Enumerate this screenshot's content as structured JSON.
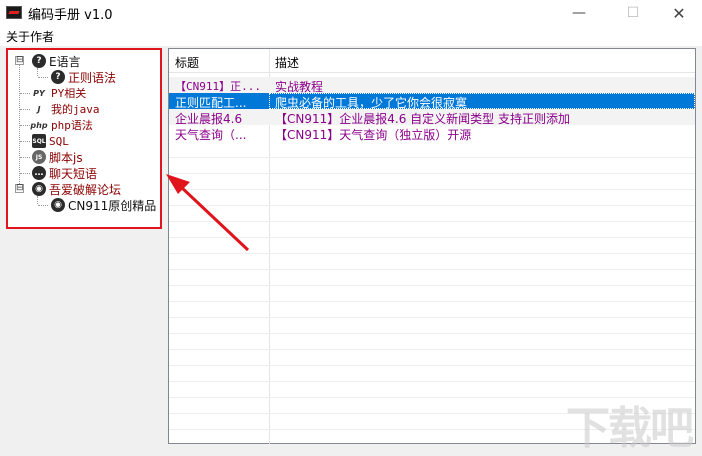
{
  "window": {
    "title": "编码手册 v1.0",
    "minimize": "—",
    "maximize": "☐",
    "close": "✕"
  },
  "menu": {
    "about": "关于作者"
  },
  "tree": {
    "items": [
      {
        "label": "E语言",
        "icon": "question-icon",
        "expander": "⊟"
      },
      {
        "label": "正则语法",
        "icon": "question-icon"
      },
      {
        "label": "PY相关",
        "icon": "py-icon"
      },
      {
        "label": "我的java",
        "icon": "java-icon"
      },
      {
        "label": "php语法",
        "icon": "php-icon"
      },
      {
        "label": "SQL",
        "icon": "sql-icon"
      },
      {
        "label": "脚本js",
        "icon": "js-icon"
      },
      {
        "label": "聊天短语",
        "icon": "chat-icon"
      },
      {
        "label": "吾爱破解论坛",
        "icon": "forum-icon",
        "expander": "⊟"
      },
      {
        "label": "CN911原创精品",
        "icon": "forum-icon"
      }
    ],
    "icon_glyphs": {
      "question": "?",
      "py": "PY",
      "java": "J",
      "php": "php",
      "sql": "SQL",
      "js": "JS",
      "chat": "…",
      "forum": "◉"
    }
  },
  "list": {
    "columns": [
      "标题",
      "描述"
    ],
    "rows": [
      {
        "title": "【CN911】正...",
        "desc": "实战教程"
      },
      {
        "title": "正则匹配工...",
        "desc": "爬虫必备的工具，少了它你会很寂寞"
      },
      {
        "title": "企业晨报4.6",
        "desc": "【CN911】企业晨报4.6 自定义新闻类型 支持正则添加"
      },
      {
        "title": "天气查询（...",
        "desc": "【CN911】天气查询（独立版）开源"
      }
    ],
    "selected_index": 1
  },
  "colors": {
    "highlight": "#e0141b",
    "selection": "#0078d7",
    "row_text": "#8b008b"
  },
  "watermark": "下载吧"
}
